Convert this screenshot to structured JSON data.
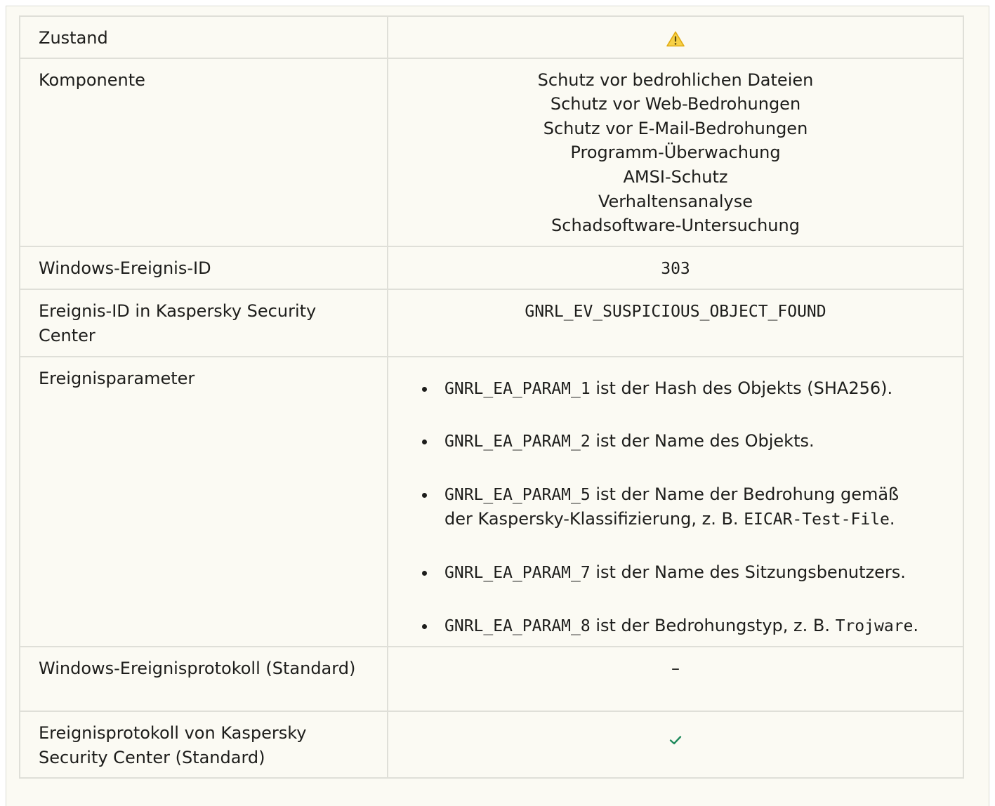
{
  "rows": {
    "state": {
      "label": "Zustand",
      "icon": "warning-icon",
      "icon_color": "#f2c018"
    },
    "component": {
      "label": "Komponente",
      "values": [
        "Schutz vor bedrohlichen Dateien",
        "Schutz vor Web-Bedrohungen",
        "Schutz vor E-Mail-Bedrohungen",
        "Programm-Überwachung",
        "AMSI-Schutz",
        "Verhaltensanalyse",
        "Schadsoftware-Untersuchung"
      ]
    },
    "windows_event_id": {
      "label": "Windows-Ereignis-ID",
      "value": "303"
    },
    "ksc_event_id": {
      "label": "Ereignis-ID in Kaspersky Security Center",
      "value": "GNRL_EV_SUSPICIOUS_OBJECT_FOUND"
    },
    "event_params": {
      "label": "Ereignisparameter",
      "items": [
        {
          "code": "GNRL_EA_PARAM_1",
          "text": " ist der Hash des Objekts (SHA256).",
          "example": "",
          "tail": ""
        },
        {
          "code": "GNRL_EA_PARAM_2",
          "text": " ist der Name des Objekts.",
          "example": "",
          "tail": ""
        },
        {
          "code": "GNRL_EA_PARAM_5",
          "text": " ist der Name der Bedrohung gemäß der Kaspersky-Klassifizierung, z. B. ",
          "example": "EICAR-Test-File",
          "tail": "."
        },
        {
          "code": "GNRL_EA_PARAM_7",
          "text": " ist der Name des Sitzungsbenutzers.",
          "example": "",
          "tail": ""
        },
        {
          "code": "GNRL_EA_PARAM_8",
          "text": " ist der Bedrohungstyp, z. B. ",
          "example": "Trojware",
          "tail": "."
        }
      ]
    },
    "windows_log": {
      "label": "Windows-Ereignisprotokoll (Standard)",
      "value": "–"
    },
    "ksc_log": {
      "label": "Ereignisprotokoll von Kaspersky Security Center (Standard)",
      "icon": "checkmark-icon",
      "icon_color": "#1f8a5c"
    }
  }
}
